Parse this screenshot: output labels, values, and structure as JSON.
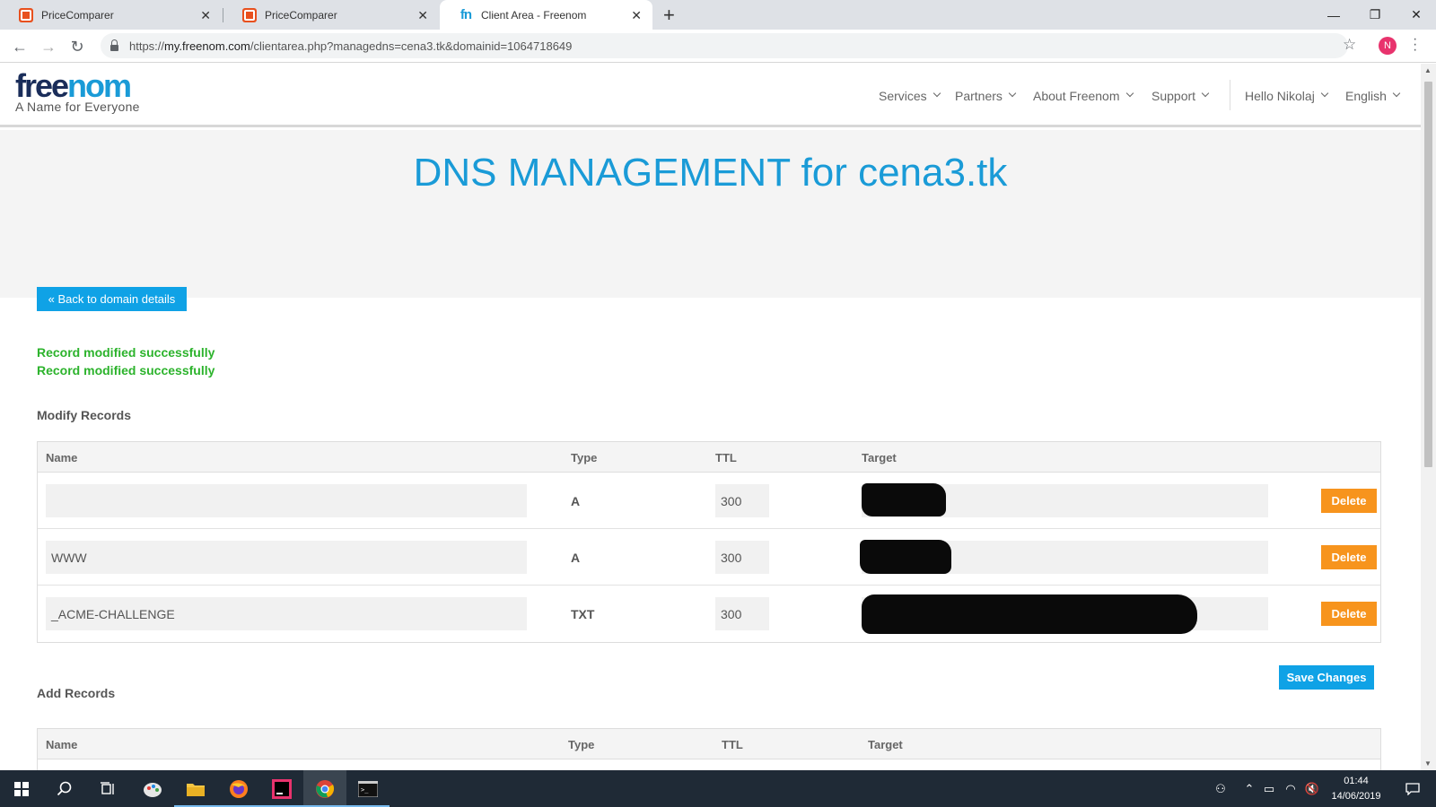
{
  "browser": {
    "tabs": [
      {
        "title": "PriceComparer",
        "active": false
      },
      {
        "title": "PriceComparer",
        "active": false
      },
      {
        "title": "Client Area - Freenom",
        "active": true
      }
    ],
    "address": {
      "scheme": "https://",
      "host": "my.freenom.com",
      "path": "/clientarea.php?managedns=cena3.tk&domainid=1064718649"
    },
    "profile_initial": "N"
  },
  "site": {
    "logo_free": "free",
    "logo_nom": "nom",
    "tagline": "A Name for Everyone",
    "nav": [
      "Services",
      "Partners",
      "About Freenom",
      "Support"
    ],
    "user_greeting": "Hello Nikolaj",
    "language": "English"
  },
  "page": {
    "title": "DNS MANAGEMENT for cena3.tk",
    "back_button": "« Back to domain details",
    "messages": [
      "Record modified successfully",
      "Record modified successfully"
    ],
    "modify_title": "Modify Records",
    "columns": {
      "name": "Name",
      "type": "Type",
      "ttl": "TTL",
      "target": "Target"
    },
    "records": [
      {
        "name": "",
        "type": "A",
        "ttl": "300"
      },
      {
        "name": "WWW",
        "type": "A",
        "ttl": "300"
      },
      {
        "name": "_ACME-CHALLENGE",
        "type": "TXT",
        "ttl": "300"
      }
    ],
    "delete_label": "Delete",
    "save_label": "Save Changes",
    "add_title": "Add Records"
  },
  "taskbar": {
    "time": "01:44",
    "date": "14/06/2019"
  },
  "colors": {
    "brand_blue": "#1a9bd7",
    "button_blue": "#0fa2e6",
    "delete_orange": "#f7941d",
    "success_green": "#2cb32c"
  }
}
